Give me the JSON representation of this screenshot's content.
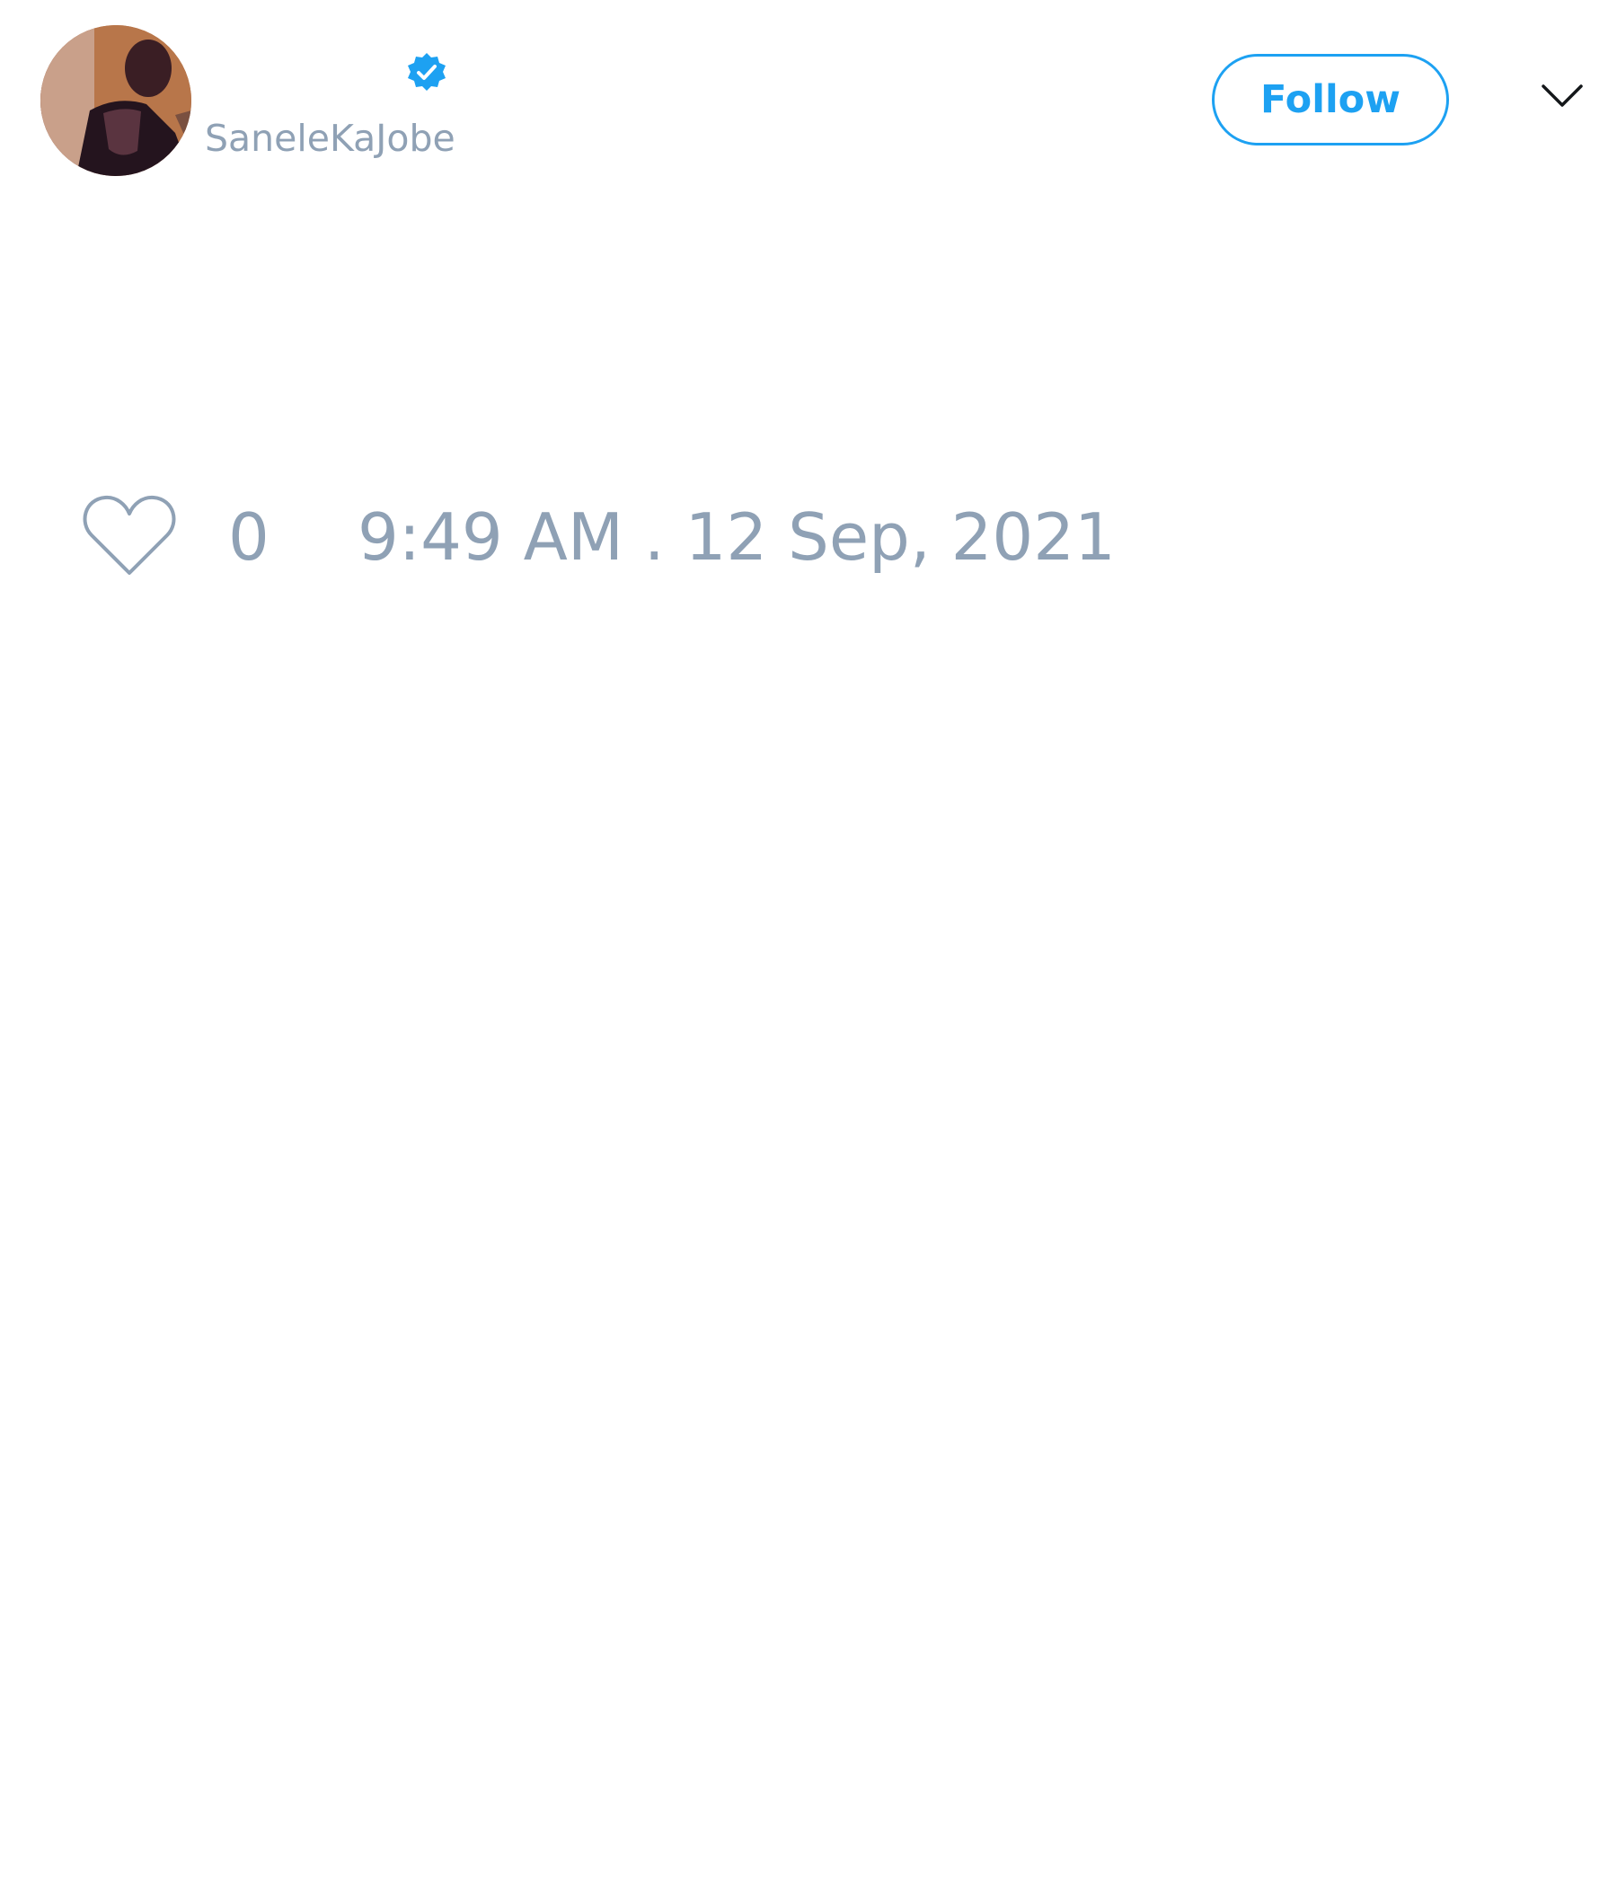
{
  "tweet": {
    "author": {
      "handle": "SaneleKaJobe",
      "verified": true,
      "avatar_icon": "user-avatar"
    },
    "follow_button": {
      "label": "Follow"
    },
    "menu_icon": "chevron-down-icon",
    "likes": {
      "icon": "heart-icon",
      "count": "0"
    },
    "timestamp": "9:49 AM . 12 Sep, 2021"
  },
  "colors": {
    "accent": "#1da1f2",
    "muted_text": "#8fa1b5",
    "background": "#ffffff"
  }
}
